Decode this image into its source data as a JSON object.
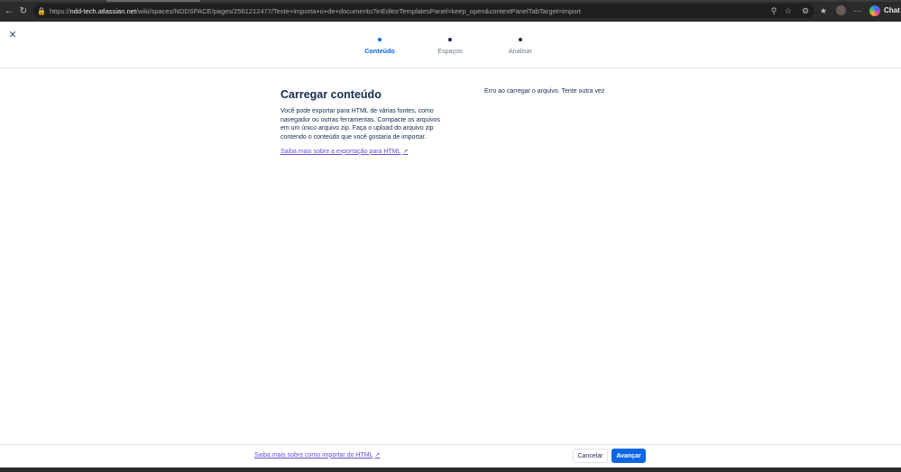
{
  "browser": {
    "url_prefix": "https://",
    "url_host": "ndd-tech.atlassian.net",
    "url_path": "/wiki/spaces/NDDSPACE/pages/2561212477/Teste+importa+o+de+documento?inEditorTemplatesPanel=keep_open&contextPanelTabTarget=import",
    "chat_label": "Chat"
  },
  "stepper": {
    "steps": [
      {
        "label": "Conteúdo"
      },
      {
        "label": "Espaços"
      },
      {
        "label": "Analisar"
      }
    ]
  },
  "main": {
    "title": "Carregar conteúdo",
    "description": "Você pode exportar para HTML de várias fontes, como navegador ou outras ferramentas. Compacte os arquivos em um único arquivo zip. Faça o upload do arquivo zip contendo o conteúdo que você gostaria de importar.",
    "learn_more": "Saiba mais sobre a exportação para HTML",
    "error": "Erro ao carregar o arquivo. Tente outra vez"
  },
  "footer": {
    "learn_more": "Saiba mais sobre como importar do HTML",
    "cancel_label": "Cancelar",
    "next_label": "Avançar"
  },
  "colors": {
    "accent": "#0c66e4",
    "link": "#6e4bd6"
  }
}
